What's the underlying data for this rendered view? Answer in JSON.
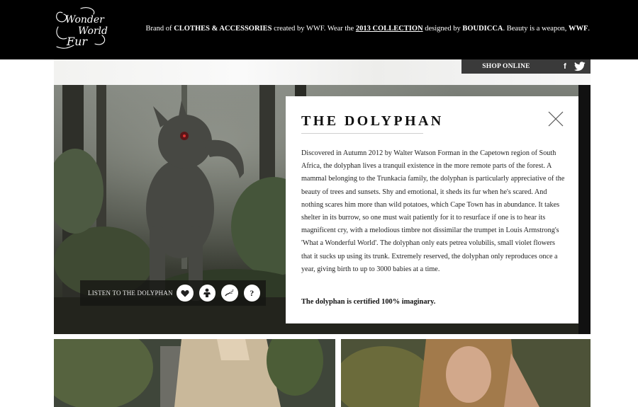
{
  "header": {
    "logo_text": "Wonder World Fur",
    "tagline": {
      "prefix": "Brand of ",
      "clothes": "CLOTHES & ACCESSORIES",
      "created": " created by WWF. Wear the ",
      "collection": "2013 COLLECTION",
      "designed": " designed by ",
      "designer": "BOUDICCA",
      "suffix": ". Beauty is a weapon, ",
      "brand": "WWF",
      "end": "."
    }
  },
  "nav": {
    "shop_online": "SHOP ONLINE",
    "facebook_glyph": "f",
    "icons": [
      "facebook-icon",
      "twitter-icon"
    ]
  },
  "hero": {
    "listen_label": "LISTEN TO THE DOLYPHAN",
    "question_glyph": "?",
    "action_icons": [
      "heart-icon",
      "baby-icon",
      "sleep-icon",
      "question-icon"
    ]
  },
  "card": {
    "title": "THE DOLYPHAN",
    "body": "Discovered in Autumn 2012 by Walter Watson Forman in the Capetown region of South Africa, the dolyphan lives a tranquil existence in the more remote parts of the forest. A mammal belonging to the Trunkacia family, the dolyphan is particularly appreciative of the beauty of trees and sunsets. Shy and emotional, it sheds its fur when he's scared. And nothing scares him more than wild potatoes, which Cape Town has in abundance. It takes shelter in its burrow, so one must wait patiently for it to resurface if one is to hear its magnificent cry, with a melodious timbre not dissimilar the trumpet in Louis Armstrong's 'What a Wonderful World'. The dolyphan only eats petrea volubilis, small violet flowers that it sucks up using its trunk. Extremely reserved, the dolyphan only reproduces once a year, giving birth to up to 3000 babies at a time.",
    "footer": "The dolyphan is certified 100% imaginary.",
    "close_icon": "close-icon"
  },
  "colors": {
    "header_bg": "#000000",
    "shop_bar": "#3a3a3a",
    "card_bg": "#ffffff",
    "text": "#222222"
  }
}
